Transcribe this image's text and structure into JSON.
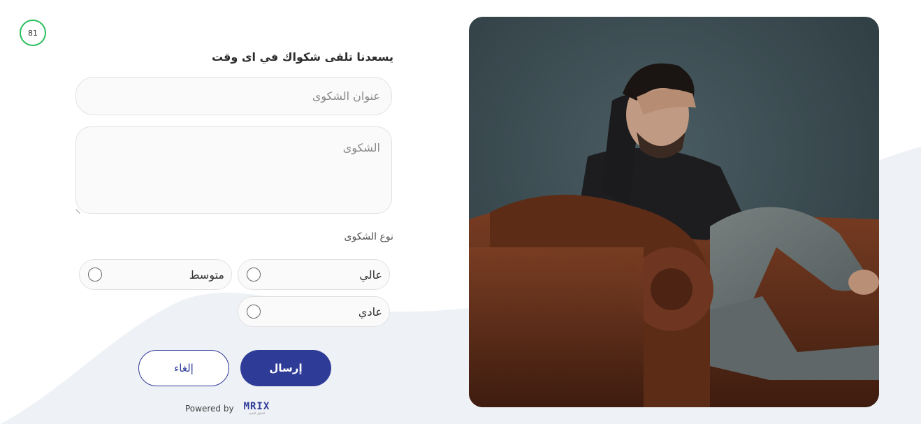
{
  "score": "81",
  "form": {
    "heading": "يسعدنا تلقى شكواك في اى وقت",
    "title_placeholder": "عنوان الشكوى",
    "complaint_placeholder": "الشكوى",
    "type_label": "نوع الشكوى",
    "options": [
      "عالي",
      "متوسط",
      "عادي"
    ],
    "send_label": "إرسال",
    "cancel_label": "إلغاء"
  },
  "footer": {
    "powered_by": "Powered by",
    "logo_text": "MRIX",
    "logo_subtext": "للحلول التقنية"
  },
  "colors": {
    "primary": "#2e3b97",
    "score_ring": "#2bbf5b",
    "wave": "#eef1f5"
  }
}
